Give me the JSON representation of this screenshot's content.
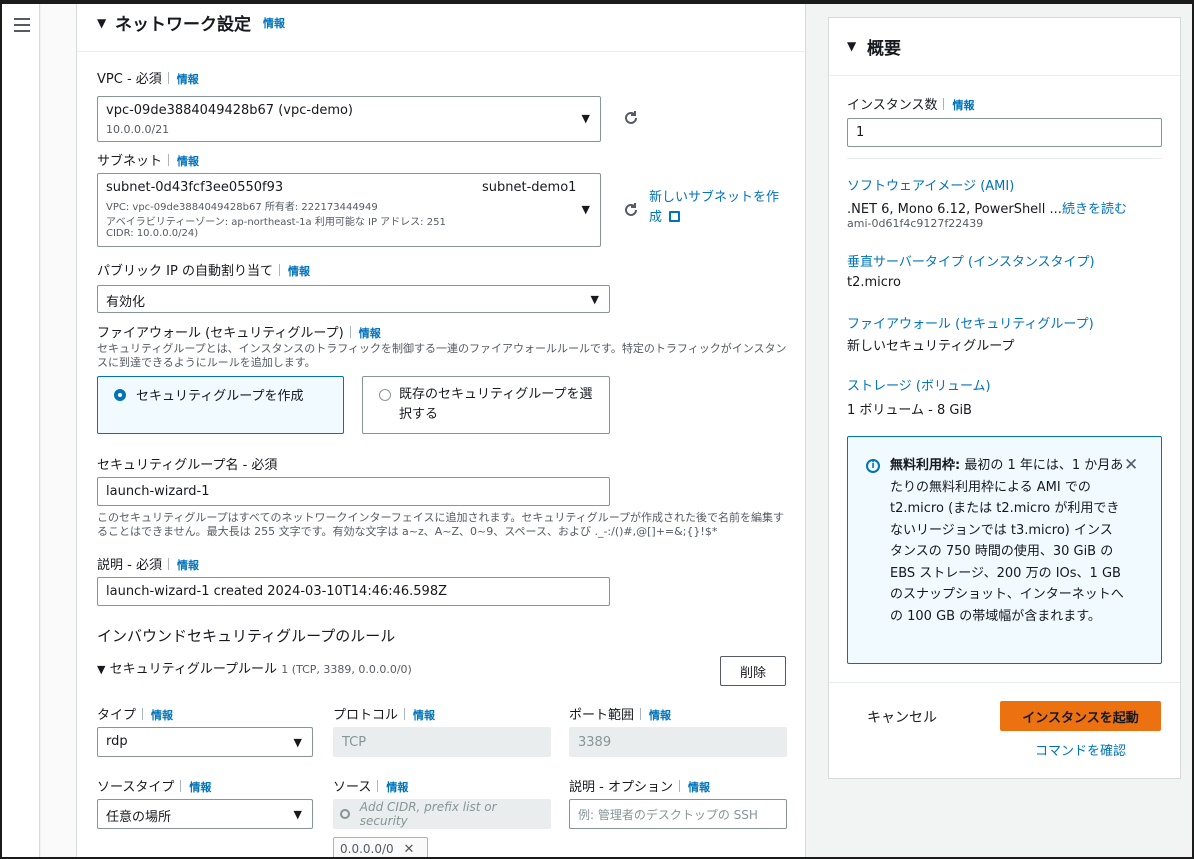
{
  "network": {
    "title": "ネットワーク設定",
    "info": "情報",
    "vpc": {
      "label": "VPC - 必須",
      "info": "情報",
      "value": "vpc-09de3884049428b67 (vpc-demo)",
      "cidr": "10.0.0.0/21"
    },
    "subnet": {
      "label": "サブネット",
      "info": "情報",
      "id": "subnet-0d43fcf3ee0550f93",
      "name": "subnet-demo1",
      "line1": "VPC: vpc-09de3884049428b67    所有者: 222173444949",
      "line2": "アベイラビリティーゾーン: ap-northeast-1a    利用可能な IP アドレス: 251",
      "line3": "CIDR: 10.0.0.0/24)",
      "new_link": "新しいサブネットを作成"
    },
    "public_ip": {
      "label": "パブリック IP の自動割り当て",
      "info": "情報",
      "value": "有効化"
    },
    "firewall": {
      "label": "ファイアウォール (セキュリティグループ)",
      "info": "情報",
      "desc": "セキュリティグループとは、インスタンスのトラフィックを制御する一連のファイアウォールルールです。特定のトラフィックがインスタンスに到達できるようにルールを追加します。",
      "opt_create": "セキュリティグループを作成",
      "opt_existing": "既存のセキュリティグループを選択する"
    },
    "sg_name": {
      "label": "セキュリティグループ名 - 必須",
      "value": "launch-wizard-1",
      "desc": "このセキュリティグループはすべてのネットワークインターフェイスに追加されます。セキュリティグループが作成された後で名前を編集することはできません。最大長は 255 文字です。有効な文字は a~z、A~Z、0~9、スペース、および ._-:/()#,@[]+=&;{}!$*"
    },
    "description": {
      "label": "説明 - 必須",
      "info": "情報",
      "value": "launch-wizard-1 created 2024-03-10T14:46:46.598Z"
    },
    "inbound": {
      "title": "インバウンドセキュリティグループのルール",
      "rule_title": "セキュリティグループルール",
      "rule_meta": "1 (TCP, 3389, 0.0.0.0/0)",
      "delete": "削除",
      "type_label": "タイプ",
      "type_value": "rdp",
      "protocol_label": "プロトコル",
      "protocol_value": "TCP",
      "port_label": "ポート範囲",
      "port_value": "3389",
      "source_type_label": "ソースタイプ",
      "source_type_value": "任意の場所",
      "source_label": "ソース",
      "source_placeholder": "Add CIDR, prefix list or security",
      "source_token": "0.0.0.0/0",
      "desc_label": "説明 - オプション",
      "desc_placeholder": "例: 管理者のデスクトップの SSH",
      "info": "情報"
    }
  },
  "summary": {
    "title": "概要",
    "count_label": "インスタンス数",
    "info": "情報",
    "count_value": "1",
    "ami_link": "ソフトウェアイメージ (AMI)",
    "ami_value": ".NET 6, Mono 6.12, PowerShell ...",
    "ami_more": "続きを読む",
    "ami_id": "ami-0d61f4c9127f22439",
    "type_link": "垂直サーバータイプ (インスタンスタイプ)",
    "type_value": "t2.micro",
    "fw_link": "ファイアウォール (セキュリティグループ)",
    "fw_value": "新しいセキュリティグループ",
    "storage_link": "ストレージ (ボリューム)",
    "storage_value": "1 ボリューム - 8 GiB",
    "free_bold": "無料利用枠:",
    "free_text": " 最初の 1 年には、1 か月あたりの無料利用枠による AMI での t2.micro (または t2.micro が利用できないリージョンでは t3.micro) インスタンスの 750 時間の使用、30 GiB の EBS ストレージ、200 万の IOs、1 GB のスナップショット、インターネットへの 100 GB の帯域幅が含まれます。",
    "cancel": "キャンセル",
    "launch": "インスタンスを起動",
    "review": "コマンドを確認"
  }
}
